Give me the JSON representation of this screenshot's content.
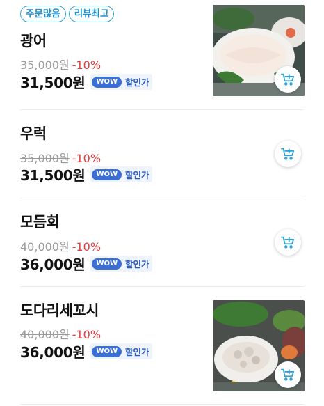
{
  "items": [
    {
      "tags": [
        "주문많음",
        "리뷰최고"
      ],
      "name": "광어",
      "original_price": "35,000원",
      "discount": "-10%",
      "price": "31,500원",
      "wow_badge": "WOW",
      "wow_label": "할인가"
    },
    {
      "name": "우럭",
      "original_price": "35,000원",
      "discount": "-10%",
      "price": "31,500원",
      "wow_badge": "WOW",
      "wow_label": "할인가"
    },
    {
      "name": "모듬회",
      "original_price": "40,000원",
      "discount": "-10%",
      "price": "36,000원",
      "wow_badge": "WOW",
      "wow_label": "할인가"
    },
    {
      "name": "도다리세꼬시",
      "original_price": "40,000원",
      "discount": "-10%",
      "price": "36,000원",
      "wow_badge": "WOW",
      "wow_label": "할인가"
    }
  ],
  "icons": {
    "cart": "add-to-cart-icon"
  },
  "colors": {
    "tag_border": "#2da3d8",
    "discount": "#e23d3d",
    "wow": "#3b6fd6",
    "cart_icon": "#2da3d8"
  }
}
